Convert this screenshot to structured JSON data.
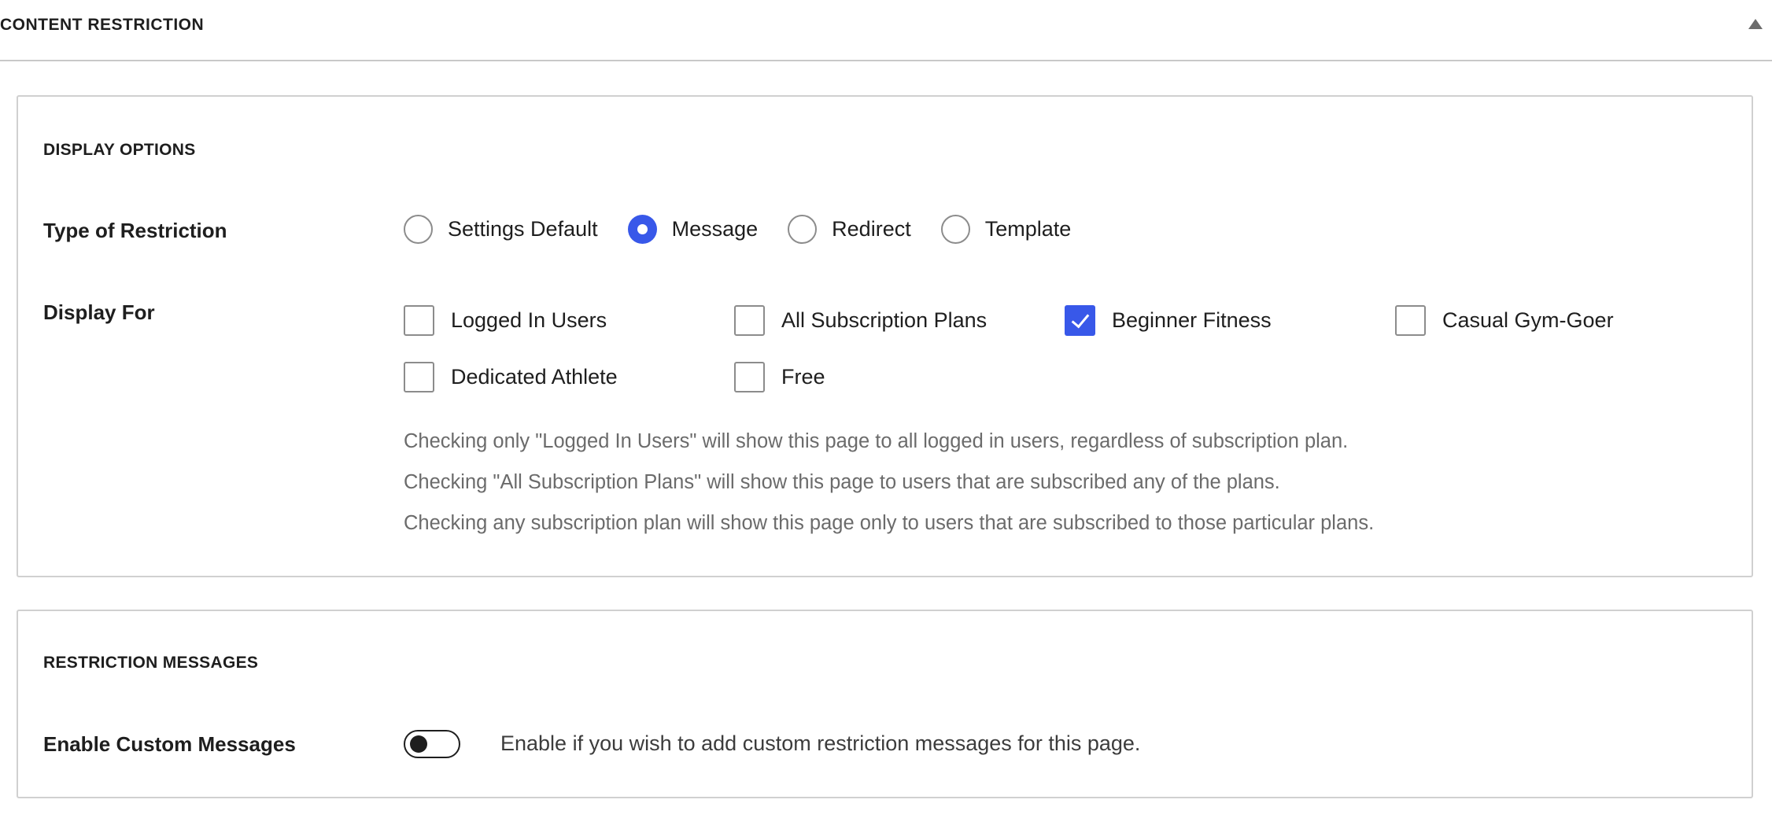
{
  "header": {
    "title": "CONTENT RESTRICTION",
    "collapse_icon": "triangle-up-icon"
  },
  "display_options": {
    "section_title": "DISPLAY OPTIONS",
    "type_of_restriction": {
      "label": "Type of Restriction",
      "options": [
        {
          "label": "Settings Default",
          "selected": false
        },
        {
          "label": "Message",
          "selected": true
        },
        {
          "label": "Redirect",
          "selected": false
        },
        {
          "label": "Template",
          "selected": false
        }
      ]
    },
    "display_for": {
      "label": "Display For",
      "options": [
        {
          "label": "Logged In Users",
          "checked": false
        },
        {
          "label": "All Subscription Plans",
          "checked": false
        },
        {
          "label": "Beginner Fitness",
          "checked": true
        },
        {
          "label": "Casual Gym-Goer",
          "checked": false
        },
        {
          "label": "Dedicated Athlete",
          "checked": false
        },
        {
          "label": "Free",
          "checked": false
        }
      ],
      "help_lines": [
        "Checking only \"Logged In Users\" will show this page to all logged in users, regardless of subscription plan.",
        "Checking \"All Subscription Plans\" will show this page to users that are subscribed any of the plans.",
        "Checking any subscription plan will show this page only to users that are subscribed to those particular plans."
      ]
    }
  },
  "restriction_messages": {
    "section_title": "RESTRICTION MESSAGES",
    "enable_custom": {
      "label": "Enable Custom Messages",
      "enabled": false,
      "help": "Enable if you wish to add custom restriction messages for this page."
    }
  },
  "colors": {
    "accent": "#3858e9",
    "text": "#1e1e1e",
    "muted_text": "#6b6b6b",
    "border": "#d0d0d0"
  }
}
